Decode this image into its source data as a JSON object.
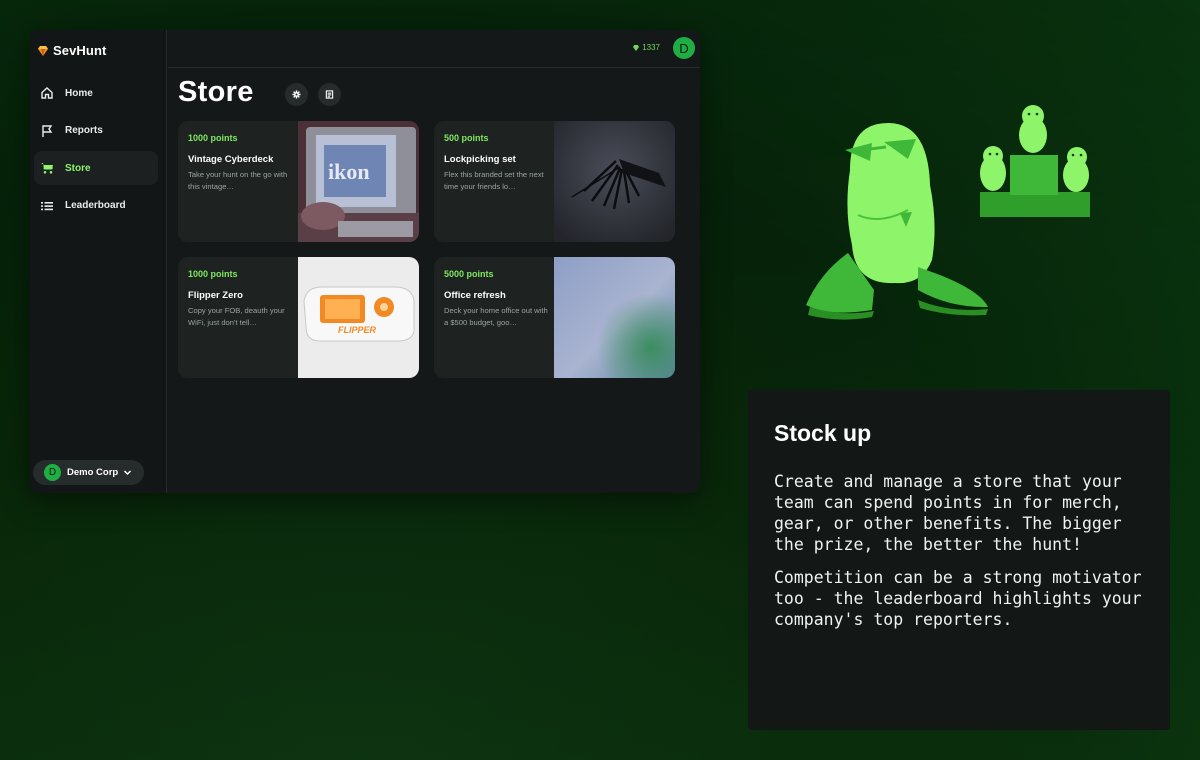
{
  "app": {
    "brand": "SevHunt",
    "nav": [
      {
        "label": "Home",
        "icon": "home-icon"
      },
      {
        "label": "Reports",
        "icon": "flag-icon"
      },
      {
        "label": "Store",
        "icon": "cart-icon",
        "active": true
      },
      {
        "label": "Leaderboard",
        "icon": "list-icon"
      }
    ],
    "org": {
      "initial": "D",
      "name": "Demo Corp"
    },
    "points_balance": "1337",
    "user_initial": "D",
    "page_title": "Store"
  },
  "store_items": [
    {
      "points": "1000 points",
      "title": "Vintage Cyberdeck",
      "desc": "Take your hunt on the go with this vintage…"
    },
    {
      "points": "500 points",
      "title": "Lockpicking set",
      "desc": "Flex this branded set the next time your friends lo…"
    },
    {
      "points": "1000 points",
      "title": "Flipper Zero",
      "desc": "Copy your FOB, deauth your WiFi, just don't tell…"
    },
    {
      "points": "5000 points",
      "title": "Office refresh",
      "desc": "Deck your home office out with a $500 budget, goo…"
    }
  ],
  "panel": {
    "title": "Stock up",
    "paragraphs": [
      "Create and manage a store that your team can spend points in for merch, gear, or other benefits. The bigger the prize, the better the hunt!",
      "Competition can be a strong motivator too - the leaderboard highlights your company's top reporters."
    ]
  },
  "colors": {
    "accent": "#8ef56b",
    "avatar": "#1fae43",
    "points": "#7ee85f"
  }
}
